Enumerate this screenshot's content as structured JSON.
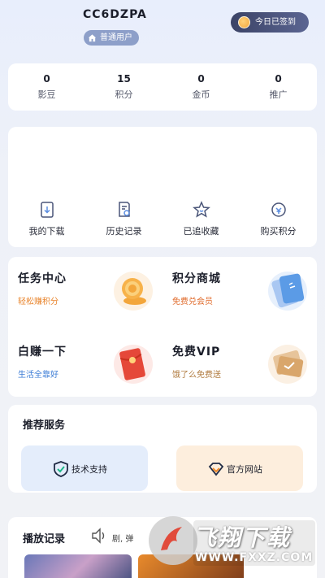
{
  "header": {
    "username": "CC6DZPA",
    "level_badge": "普通用户",
    "signin_label": "今日已签到"
  },
  "stats": [
    {
      "value": "0",
      "label": "影豆"
    },
    {
      "value": "15",
      "label": "积分"
    },
    {
      "value": "0",
      "label": "金币"
    },
    {
      "value": "0",
      "label": "推广"
    }
  ],
  "quick_actions": [
    {
      "label": "我的下载",
      "icon": "download-icon"
    },
    {
      "label": "历史记录",
      "icon": "history-icon"
    },
    {
      "label": "已追收藏",
      "icon": "star-icon"
    },
    {
      "label": "购买积分",
      "icon": "coin-icon"
    }
  ],
  "features": [
    {
      "title": "任务中心",
      "subtitle": "轻松赚积分",
      "subtitle_color": "#e8842c",
      "icon": "coin-stack-icon"
    },
    {
      "title": "积分商城",
      "subtitle": "免费兑会员",
      "subtitle_color": "#e06a2a",
      "icon": "ticket-icon"
    },
    {
      "title": "白赚一下",
      "subtitle": "生活全靠好",
      "subtitle_color": "#3a7bd5",
      "icon": "red-envelope-icon"
    },
    {
      "title": "免费VIP",
      "subtitle": "饿了么免费送",
      "subtitle_color": "#b07a3e",
      "icon": "coupon-icon"
    }
  ],
  "services": {
    "title": "推荐服务",
    "items": [
      {
        "label": "技术支持",
        "icon": "shield-check-icon",
        "bg": "#e4edfb"
      },
      {
        "label": "官方网站",
        "icon": "diamond-icon",
        "bg": "#fdeedd"
      }
    ]
  },
  "history": {
    "title": "播放记录",
    "marquee": "剧, 弹"
  },
  "watermark": {
    "text": "飞翔下载",
    "url": "WWW.FXXZ.COM"
  }
}
